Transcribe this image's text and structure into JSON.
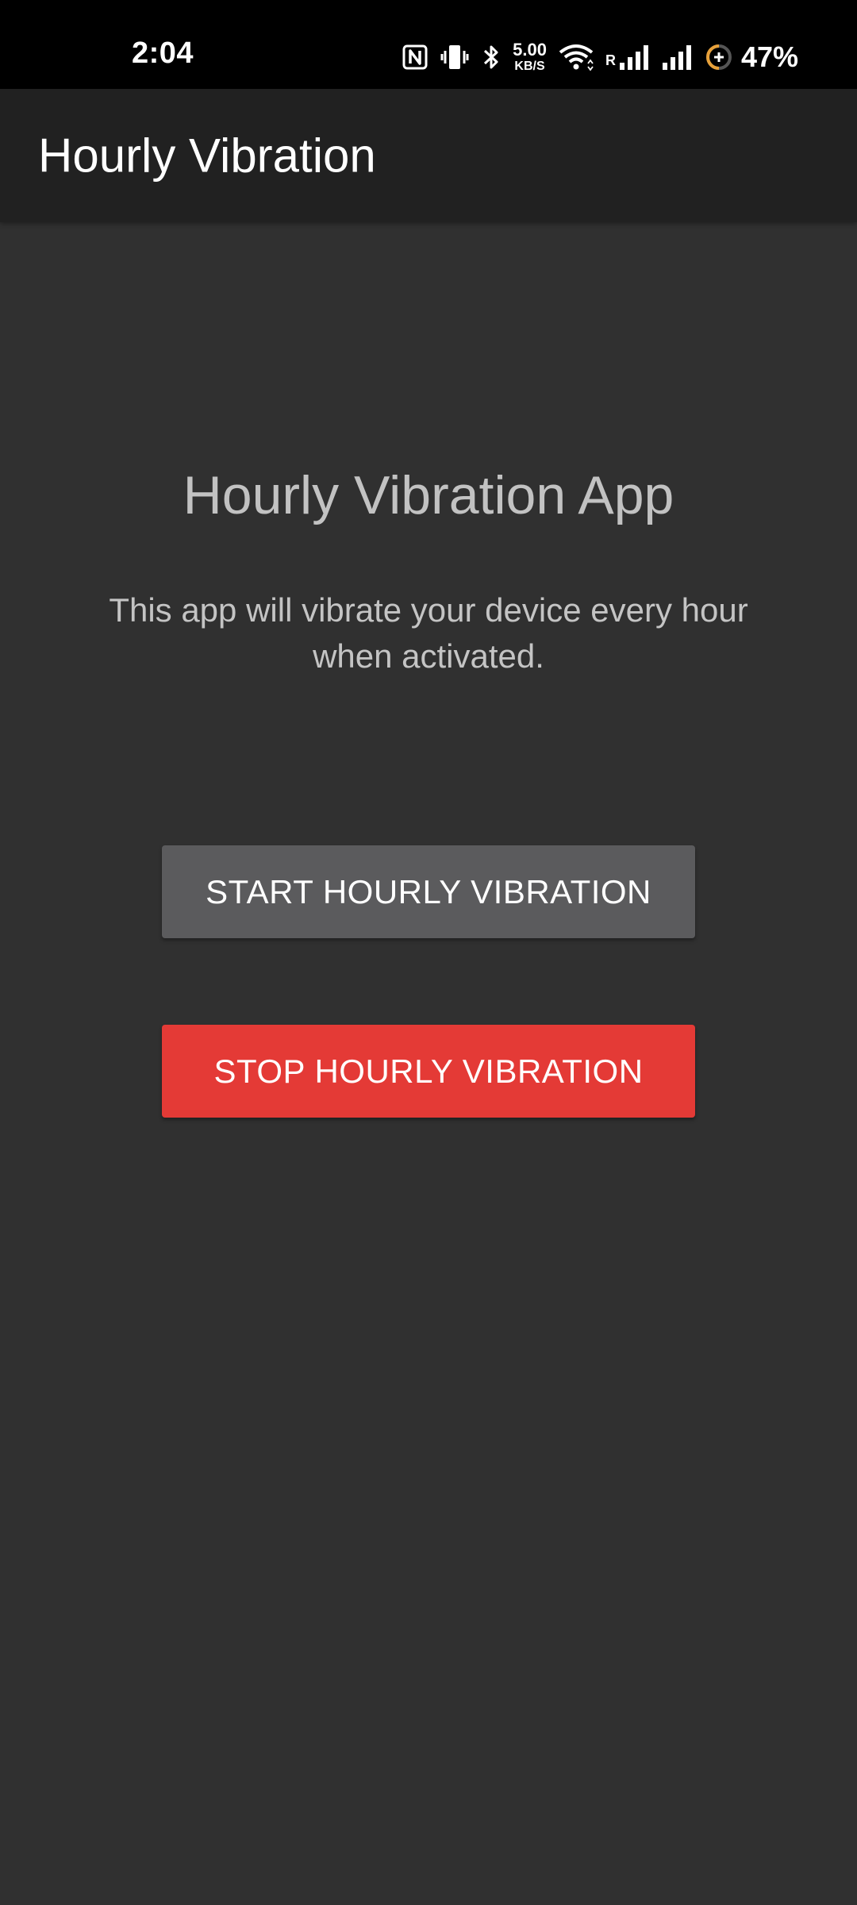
{
  "status_bar": {
    "time": "2:04",
    "net_speed_value": "5.00",
    "net_speed_unit": "KB/S",
    "roaming_indicator": "R",
    "battery_percent": "47%",
    "icons": [
      "nfc-icon",
      "vibrate-icon",
      "bluetooth-icon",
      "wifi-icon",
      "signal-icon",
      "signal-icon",
      "battery-saver-icon"
    ]
  },
  "app_bar": {
    "title": "Hourly Vibration"
  },
  "main": {
    "heading": "Hourly Vibration App",
    "description": "This app will vibrate your device every hour when activated.",
    "start_button_label": "START HOURLY VIBRATION",
    "stop_button_label": "STOP HOURLY VIBRATION"
  },
  "colors": {
    "status_bar_bg": "#000000",
    "app_bar_bg": "#212121",
    "background": "#303030",
    "start_button_bg": "#5b5b5d",
    "stop_button_bg": "#e43a36",
    "battery_ring_accent": "#e8a13a"
  }
}
